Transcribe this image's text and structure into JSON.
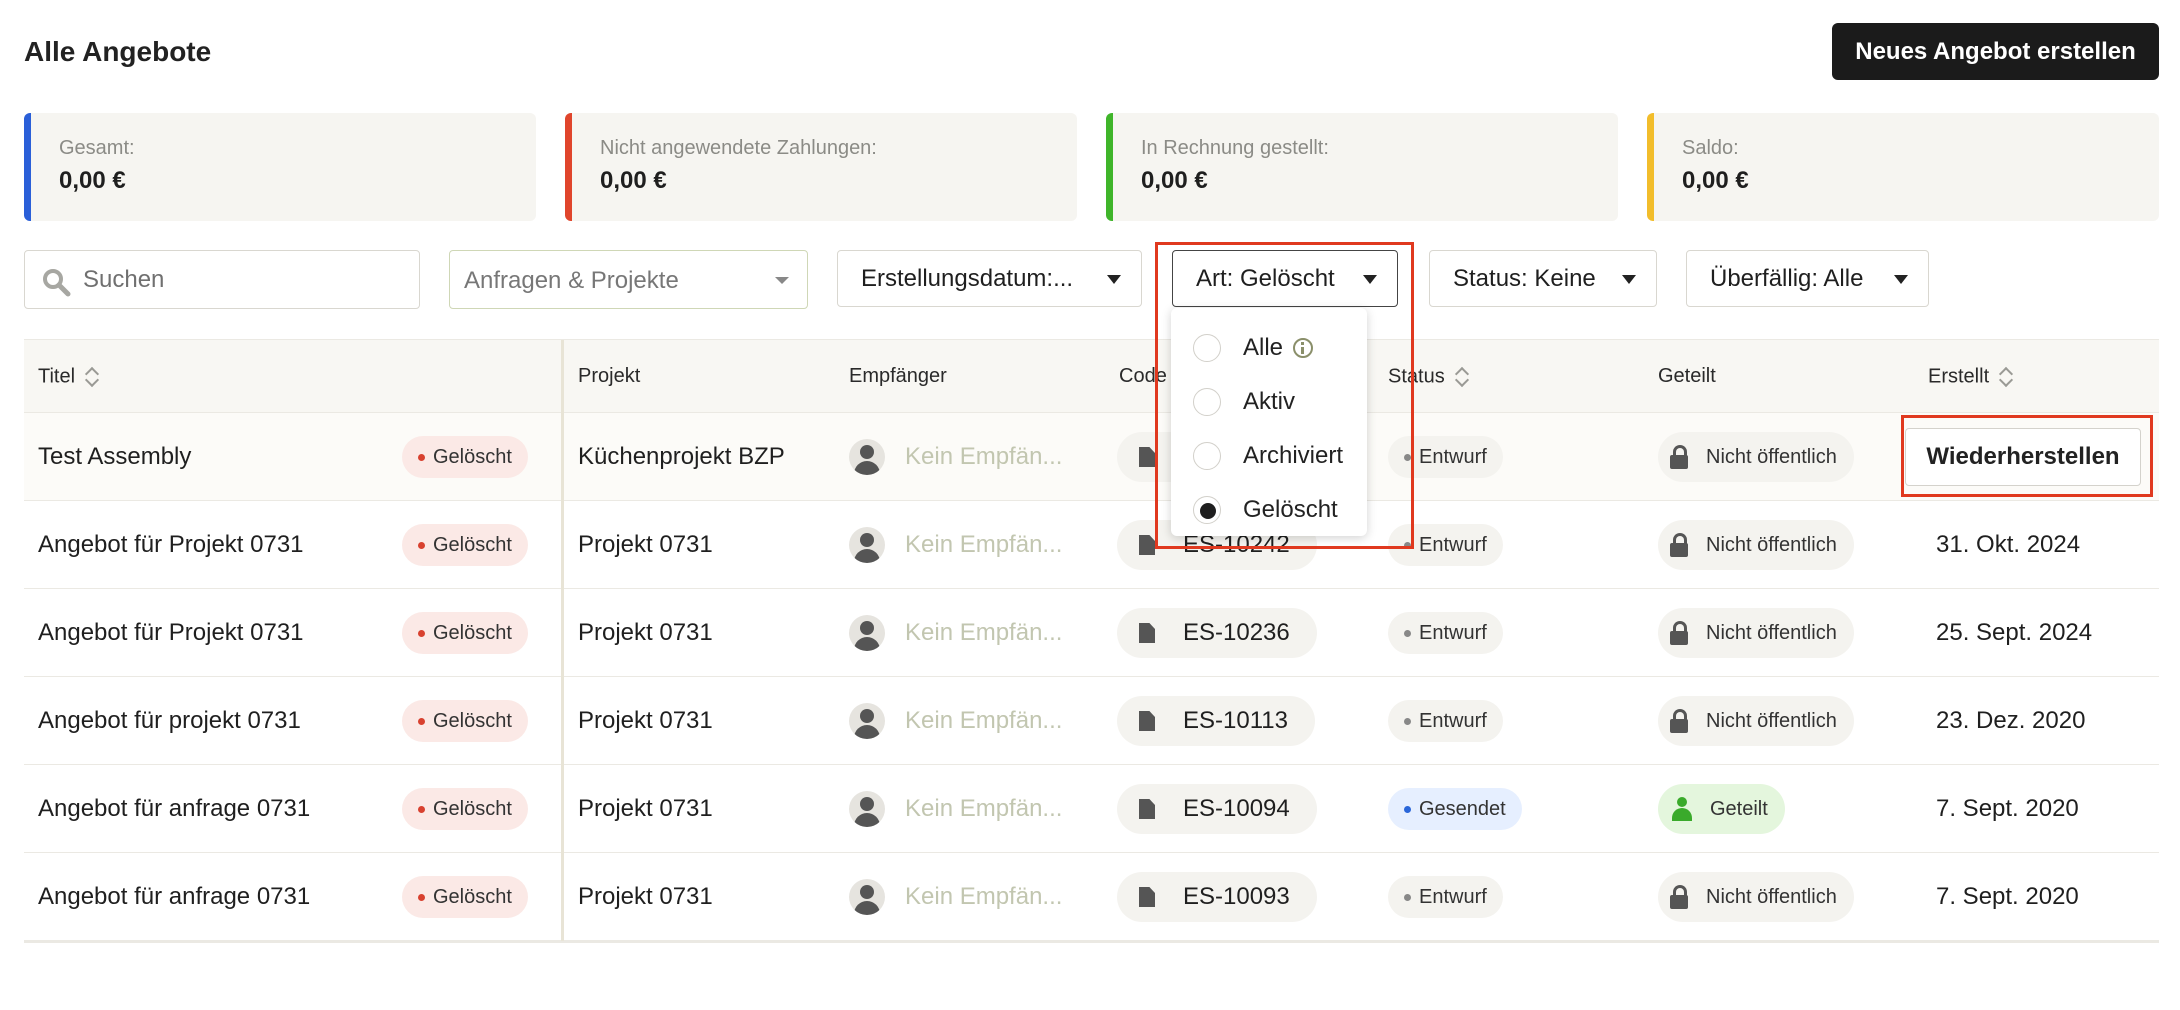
{
  "header": {
    "title": "Alle Angebote",
    "new_button": "Neues Angebot erstellen"
  },
  "summary": [
    {
      "label": "Gesamt:",
      "value": "0,00 €",
      "color": "#2a5fd8"
    },
    {
      "label": "Nicht angewendete Zahlungen:",
      "value": "0,00 €",
      "color": "#e0452c"
    },
    {
      "label": "In Rechnung gestellt:",
      "value": "0,00 €",
      "color": "#3fb52a"
    },
    {
      "label": "Saldo:",
      "value": "0,00 €",
      "color": "#f2bd2b"
    }
  ],
  "filters": {
    "search_placeholder": "Suchen",
    "project_select": "Anfragen & Projekte",
    "created_date": "Erstellungsdatum:...",
    "type": "Art: Gelöscht",
    "status": "Status: Keine",
    "overdue": "Überfällig: Alle"
  },
  "type_dropdown": {
    "options": [
      "Alle",
      "Aktiv",
      "Archiviert",
      "Gelöscht"
    ],
    "selected": "Gelöscht"
  },
  "table": {
    "columns": [
      "Titel",
      "Projekt",
      "Empfänger",
      "Code",
      "Status",
      "Geteilt",
      "Erstellt"
    ],
    "rows": [
      {
        "title": "Test Assembly",
        "badge": "Gelöscht",
        "project": "Küchenprojekt BZP",
        "recipient": "Kein Empfän...",
        "code": "",
        "status": "Entwurf",
        "shared": "Nicht öffentlich",
        "created": ""
      },
      {
        "title": "Angebot für Projekt 0731",
        "badge": "Gelöscht",
        "project": "Projekt 0731",
        "recipient": "Kein Empfän...",
        "code": "ES-10242",
        "status": "Entwurf",
        "shared": "Nicht öffentlich",
        "created": "31. Okt. 2024"
      },
      {
        "title": "Angebot für Projekt 0731",
        "badge": "Gelöscht",
        "project": "Projekt 0731",
        "recipient": "Kein Empfän...",
        "code": "ES-10236",
        "status": "Entwurf",
        "shared": "Nicht öffentlich",
        "created": "25. Sept. 2024"
      },
      {
        "title": "Angebot für projekt 0731",
        "badge": "Gelöscht",
        "project": "Projekt 0731",
        "recipient": "Kein Empfän...",
        "code": "ES-10113",
        "status": "Entwurf",
        "shared": "Nicht öffentlich",
        "created": "23. Dez. 2020"
      },
      {
        "title": "Angebot für anfrage 0731",
        "badge": "Gelöscht",
        "project": "Projekt 0731",
        "recipient": "Kein Empfän...",
        "code": "ES-10094",
        "status": "Gesendet",
        "shared": "Geteilt",
        "created": "7. Sept. 2020"
      },
      {
        "title": "Angebot für anfrage 0731",
        "badge": "Gelöscht",
        "project": "Projekt 0731",
        "recipient": "Kein Empfän...",
        "code": "ES-10093",
        "status": "Entwurf",
        "shared": "Nicht öffentlich",
        "created": "7. Sept. 2020"
      }
    ],
    "restore_button": "Wiederherstellen"
  }
}
